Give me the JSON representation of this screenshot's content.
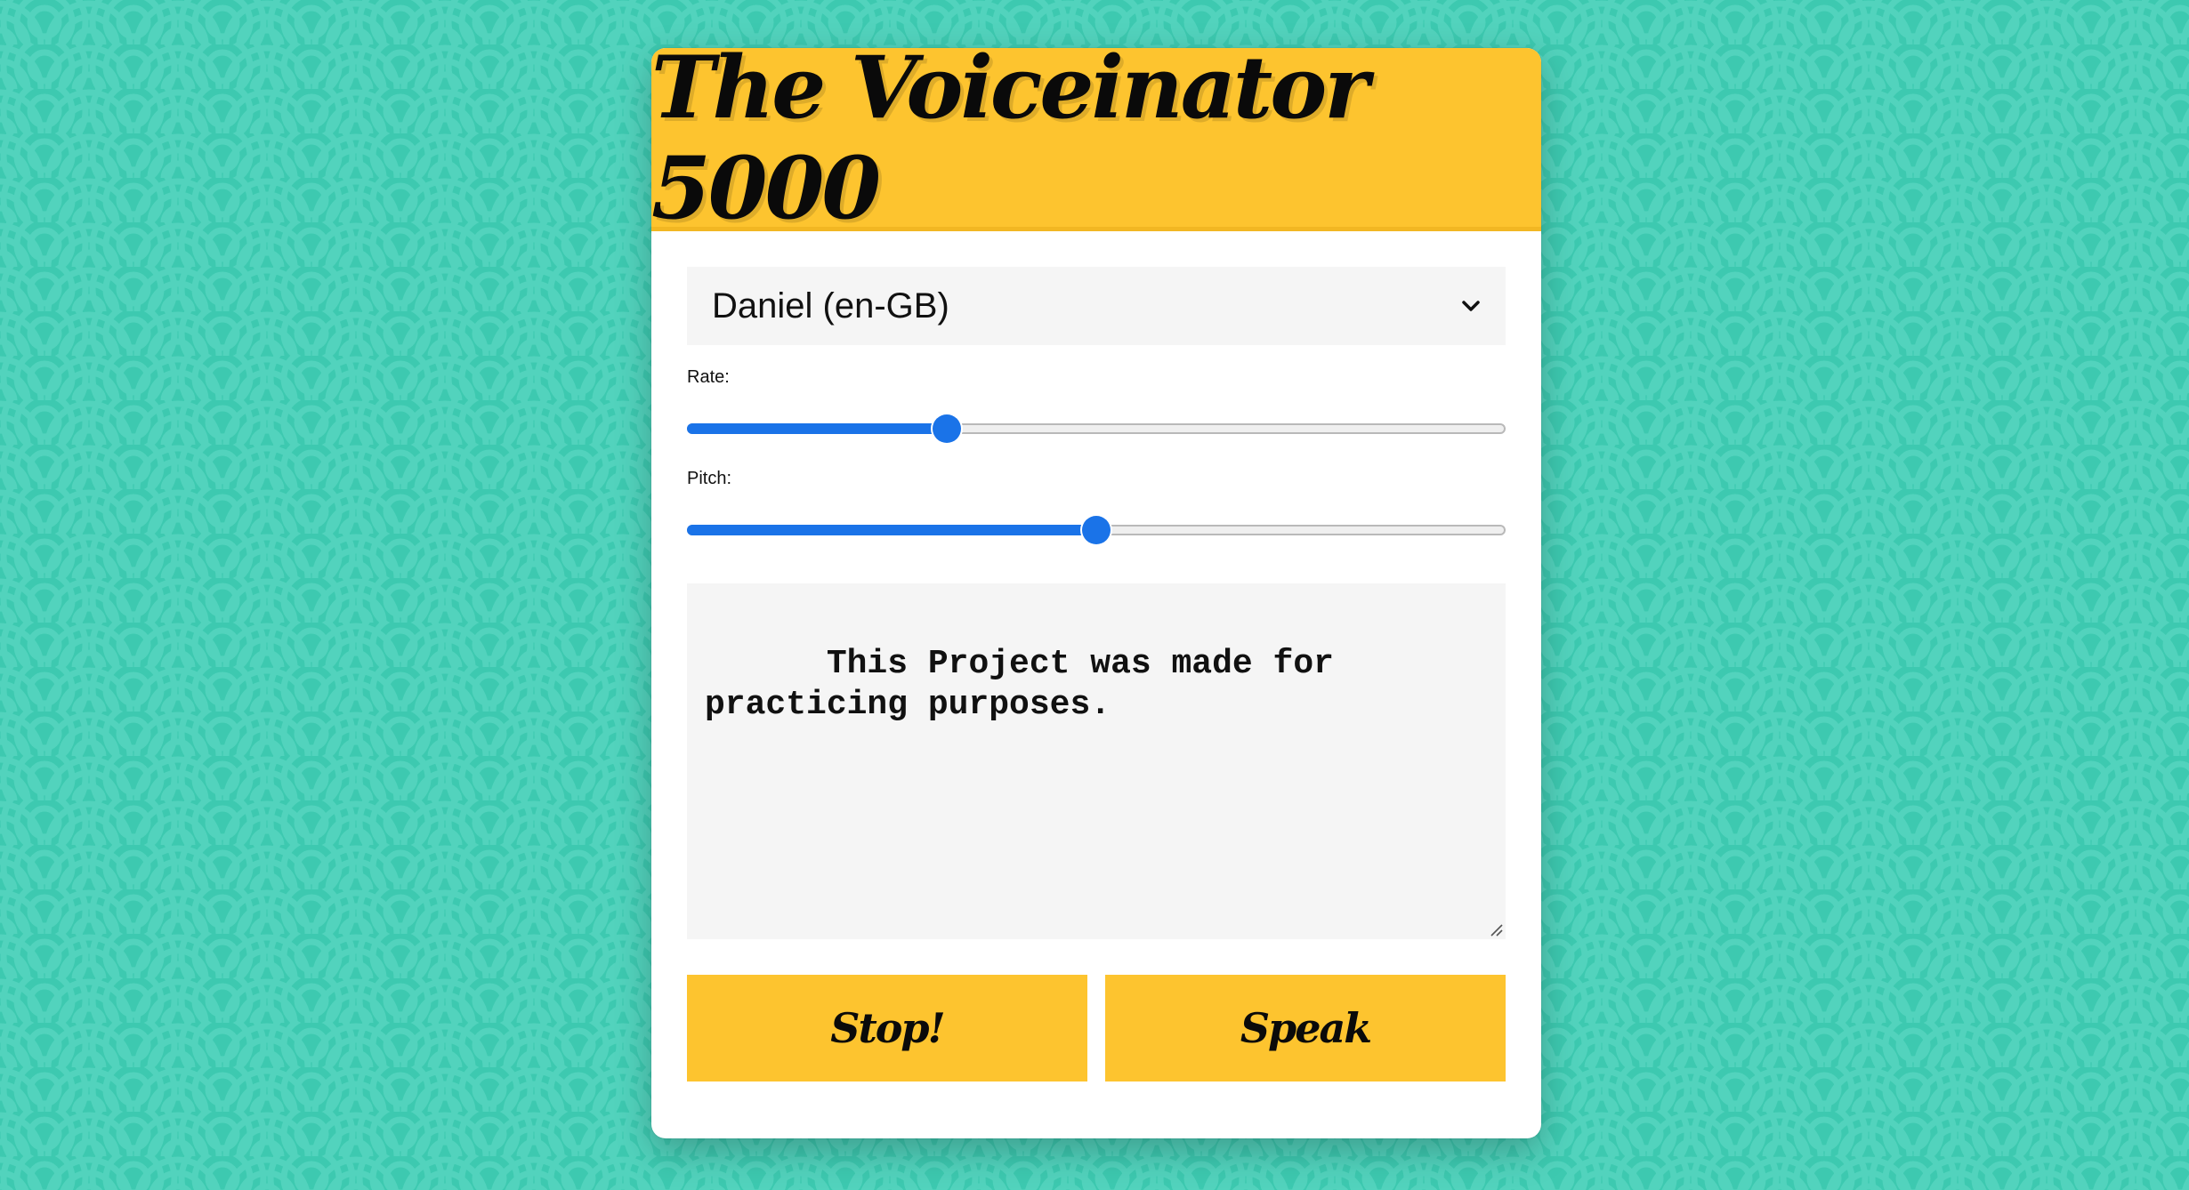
{
  "app": {
    "title": "The Voiceinator 5000"
  },
  "voice_select": {
    "selected": "Daniel (en-GB)",
    "icon": "chevron-down-icon"
  },
  "rate": {
    "label": "Rate:",
    "min": 0.1,
    "max": 3,
    "value": 1
  },
  "pitch": {
    "label": "Pitch:",
    "min": 0,
    "max": 2,
    "value": 1
  },
  "message": {
    "text": "This Project was made for practicing purposes."
  },
  "buttons": {
    "stop_label": "Stop!",
    "speak_label": "Speak"
  },
  "colors": {
    "background": "#3dc9b0",
    "accent": "#fdc42f",
    "slider": "#1a73e8"
  }
}
